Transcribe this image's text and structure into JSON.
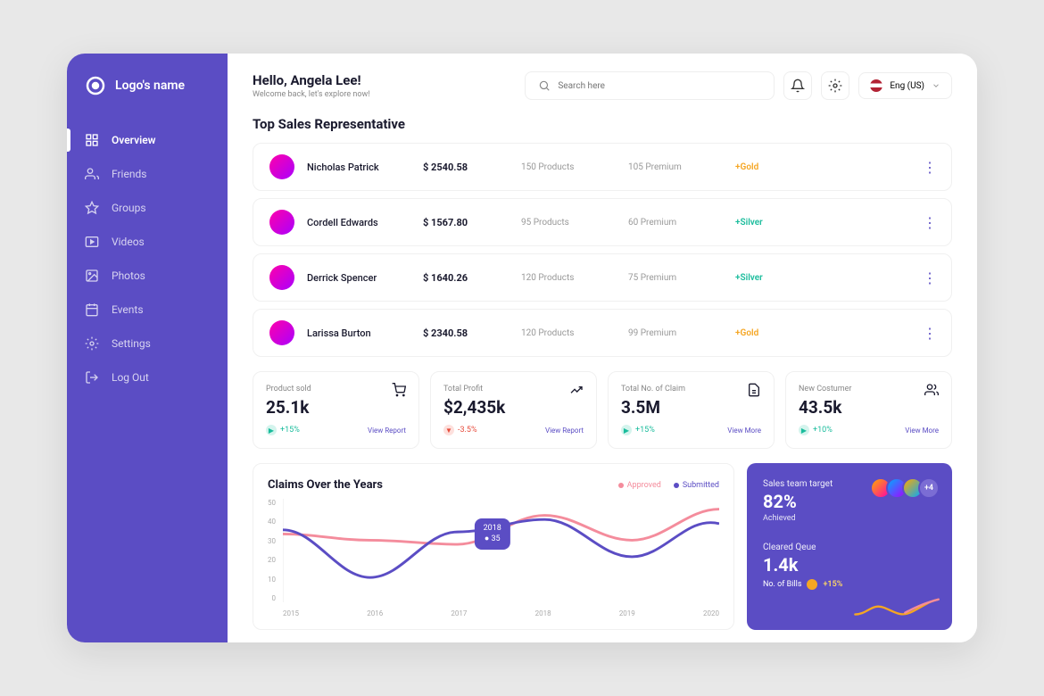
{
  "brand": {
    "name": "Logo's name"
  },
  "nav": {
    "items": [
      {
        "label": "Overview",
        "active": true
      },
      {
        "label": "Friends",
        "active": false
      },
      {
        "label": "Groups",
        "active": false
      },
      {
        "label": "Videos",
        "active": false
      },
      {
        "label": "Photos",
        "active": false
      },
      {
        "label": "Events",
        "active": false
      },
      {
        "label": "Settings",
        "active": false
      },
      {
        "label": "Log Out",
        "active": false
      }
    ]
  },
  "header": {
    "greeting": "Hello, Angela Lee!",
    "subtitle": "Welcome back, let's explore now!",
    "search_placeholder": "Search here",
    "language": "Eng (US)"
  },
  "reps": {
    "title": "Top Sales Representative",
    "rows": [
      {
        "name": "Nicholas Patrick",
        "amount": "$ 2540.58",
        "products": "150 Products",
        "premium": "105 Premium",
        "badge": "+Gold",
        "badge_class": "badge-gold"
      },
      {
        "name": "Cordell Edwards",
        "amount": "$ 1567.80",
        "products": "95 Products",
        "premium": "60 Premium",
        "badge": "+Silver",
        "badge_class": "badge-silver"
      },
      {
        "name": "Derrick Spencer",
        "amount": "$ 1640.26",
        "products": "120 Products",
        "premium": "75 Premium",
        "badge": "+Silver",
        "badge_class": "badge-silver"
      },
      {
        "name": "Larissa Burton",
        "amount": "$ 2340.58",
        "products": "120 Products",
        "premium": "99 Premium",
        "badge": "+Gold",
        "badge_class": "badge-gold"
      }
    ]
  },
  "stats": [
    {
      "label": "Product sold",
      "value": "25.1k",
      "change": "+15%",
      "dir": "up",
      "link": "View Report"
    },
    {
      "label": "Total Profit",
      "value": "$2,435k",
      "change": "-3.5%",
      "dir": "down",
      "link": "View Report"
    },
    {
      "label": "Total No. of Claim",
      "value": "3.5M",
      "change": "+15%",
      "dir": "up",
      "link": "View More"
    },
    {
      "label": "New Costumer",
      "value": "43.5k",
      "change": "+10%",
      "dir": "up",
      "link": "View More"
    }
  ],
  "chart": {
    "title": "Claims Over the Years",
    "legend": [
      {
        "label": "Approved",
        "color": "pink"
      },
      {
        "label": "Submitted",
        "color": "purple"
      }
    ],
    "tooltip": {
      "year": "2018",
      "value": "35"
    }
  },
  "target": {
    "label": "Sales team target",
    "value": "82%",
    "status": "Achieved",
    "avatars_more": "+4",
    "queue_label": "Cleared Qeue",
    "queue_value": "1.4k",
    "bills_label": "No. of Bills",
    "bills_change": "+15%"
  },
  "chart_data": {
    "type": "line",
    "title": "Claims Over the Years",
    "xlabel": "",
    "ylabel": "",
    "ylim": [
      0,
      50
    ],
    "categories": [
      "2015",
      "2016",
      "2017",
      "2018",
      "2019",
      "2020"
    ],
    "series": [
      {
        "name": "Approved",
        "values": [
          33,
          30,
          28,
          42,
          30,
          45
        ]
      },
      {
        "name": "Submitted",
        "values": [
          35,
          12,
          34,
          40,
          22,
          42
        ]
      }
    ],
    "tooltip": {
      "x": "2018",
      "value": 35
    }
  }
}
